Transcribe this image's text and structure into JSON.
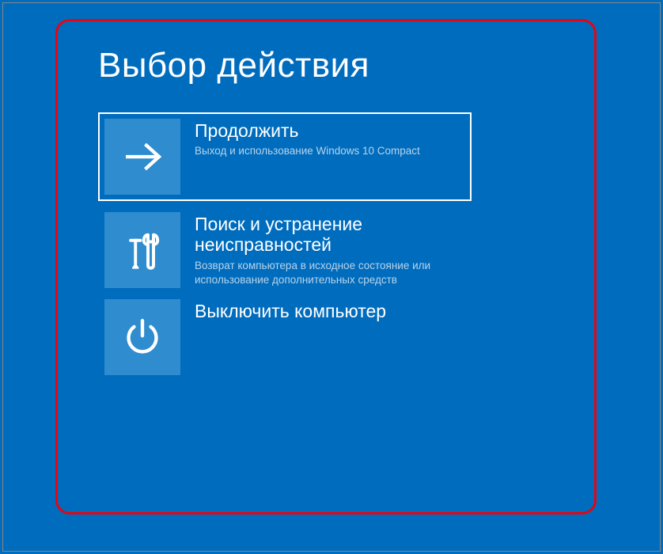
{
  "page_title": "Выбор действия",
  "options": [
    {
      "title": "Продолжить",
      "desc": "Выход и использование Windows 10 Compact",
      "icon": "arrow-right-icon",
      "selected": true
    },
    {
      "title": "Поиск и устранение неисправностей",
      "desc": "Возврат компьютера в исходное состояние или использование дополнительных средств",
      "icon": "tools-icon",
      "selected": false
    },
    {
      "title": "Выключить компьютер",
      "desc": "",
      "icon": "power-icon",
      "selected": false
    }
  ],
  "colors": {
    "background": "#006cbe",
    "tile": "#2e8ccf",
    "highlight_border": "#e30613"
  }
}
